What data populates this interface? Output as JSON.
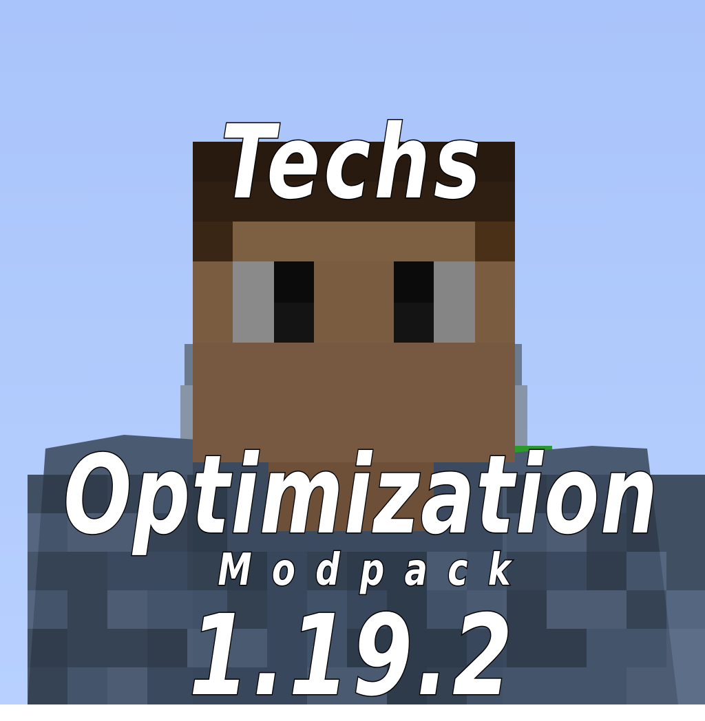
{
  "thumbnail": {
    "title_line_1": "Techs",
    "title_line_2": "Optimization",
    "subtitle": "Modpack",
    "version": "1.19.2"
  },
  "colors": {
    "sky_top": "#a9c4fa",
    "sky_bottom": "#b7d0ff",
    "hair": "#2f1f12",
    "skin": "#7a5c40",
    "eye_white": "#8a8a8a",
    "pupil": "#0b0b0b",
    "jacket": "#3b4a5e",
    "text": "#ffffff",
    "text_outline": "#000000"
  }
}
